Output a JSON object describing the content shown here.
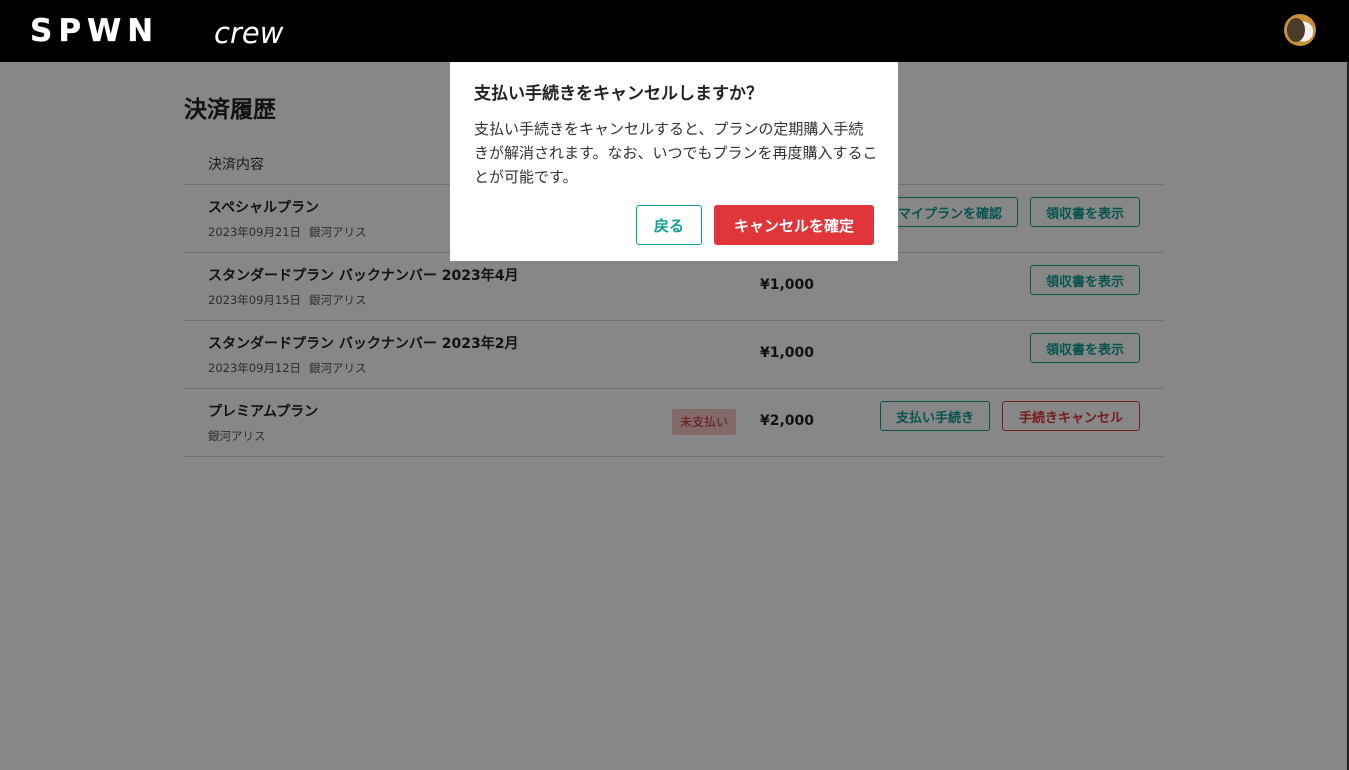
{
  "header": {
    "logo_text": "SPWN crew",
    "logo_main": "SPWN",
    "logo_sub": "crew",
    "avatar_icon": "user-avatar-icon"
  },
  "page": {
    "title": "決済履歴",
    "column_header": "決済内容"
  },
  "rows": [
    {
      "title": "スペシャルプラン",
      "date": "2023年09月21日",
      "user": "銀河アリス",
      "price": "",
      "buttons": [
        "マイプランを確認",
        "領収書を表示"
      ]
    },
    {
      "title": "スタンダードプラン バックナンバー 2023年4月",
      "date": "2023年09月15日",
      "user": "銀河アリス",
      "price": "¥1,000",
      "buttons": [
        "領収書を表示"
      ]
    },
    {
      "title": "スタンダードプラン バックナンバー 2023年2月",
      "date": "2023年09月12日",
      "user": "銀河アリス",
      "price": "¥1,000",
      "buttons": [
        "領収書を表示"
      ]
    },
    {
      "title": "プレミアムプラン",
      "date": "",
      "user": "銀河アリス",
      "badge": "未支払い",
      "price": "¥2,000",
      "buttons": [
        "支払い手続き",
        "手続きキャンセル"
      ]
    }
  ],
  "modal": {
    "title": "支払い手続きをキャンセルしますか？",
    "body": "支払い手続きをキャンセルすると、プランの定期購入手続きが解消されます。なお、いつでもプランを再度購入することが可能です。",
    "back_label": "戻る",
    "confirm_label": "キャンセルを確定"
  },
  "colors": {
    "accent_teal": "#0f9f95",
    "danger_red": "#e0363a",
    "header_bg": "#000000"
  }
}
